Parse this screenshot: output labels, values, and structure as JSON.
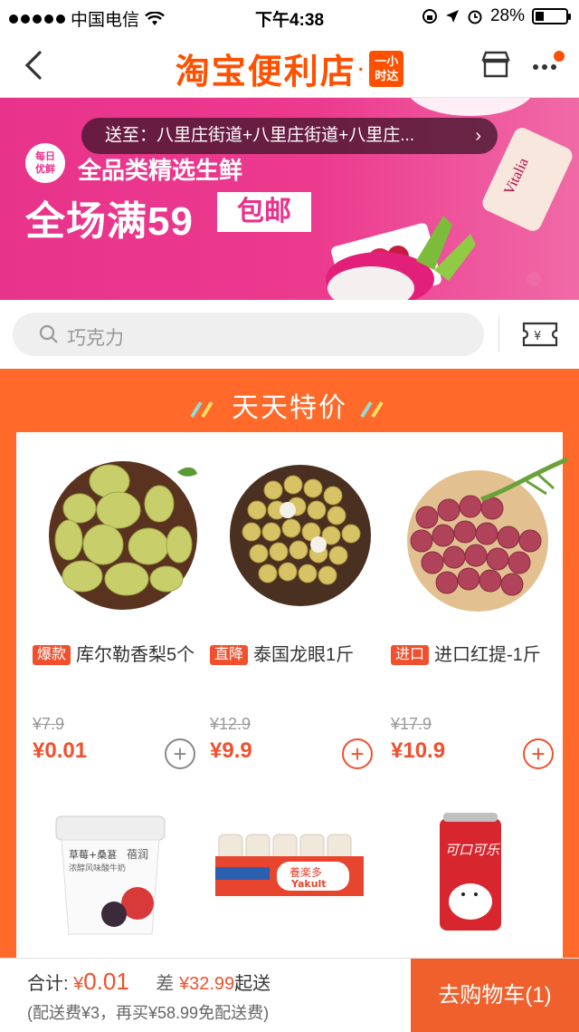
{
  "status_bar": {
    "carrier": "中国电信",
    "time": "下午4:38",
    "battery": "28%",
    "battery_level": 0.28
  },
  "nav": {
    "title": "淘宝便利店",
    "title_dot": "·",
    "badge_line1": "一小",
    "badge_line2": "时达"
  },
  "banner": {
    "address_prefix": "送至：",
    "address": "八里庄街道+八里庄街道+八里庄...",
    "daily_line1": "每日",
    "daily_line2": "优鲜",
    "line1": "全品类精选生鲜",
    "line2": "全场满59",
    "free_shipping": "包邮"
  },
  "search": {
    "placeholder": "巧克力"
  },
  "deals": {
    "title": "天天特价",
    "products": [
      {
        "tag": "爆款",
        "name": "库尔勒香梨5个",
        "old_price": "¥7.9",
        "price": "¥0.01",
        "add": "+"
      },
      {
        "tag": "直降",
        "name": "泰国龙眼1斤",
        "old_price": "¥12.9",
        "price": "¥9.9",
        "add": "+"
      },
      {
        "tag": "进口",
        "name": "进口红提-1斤",
        "old_price": "¥17.9",
        "price": "¥10.9",
        "add": "+"
      }
    ],
    "yogurt_label1": "草莓+桑葚",
    "yogurt_label2": "浓醇风味酸牛奶",
    "yogurt_brand": "蓓润",
    "yakult_brand": "養楽多",
    "yakult_brand_en": "Yakult",
    "coke_brand": "可口可乐"
  },
  "cart": {
    "total_label": "合计:",
    "currency": "¥",
    "total": "0.01",
    "diff_label": "差",
    "diff_value": "¥32.99",
    "diff_suffix": "起送",
    "fee_note": "(配送费¥3，再买¥58.99免配送费)",
    "button": "去购物车(1)"
  },
  "colors": {
    "accent": "#ff5000",
    "banner": "#e8338a",
    "section": "#ff6a2b",
    "price": "#f0502d"
  }
}
